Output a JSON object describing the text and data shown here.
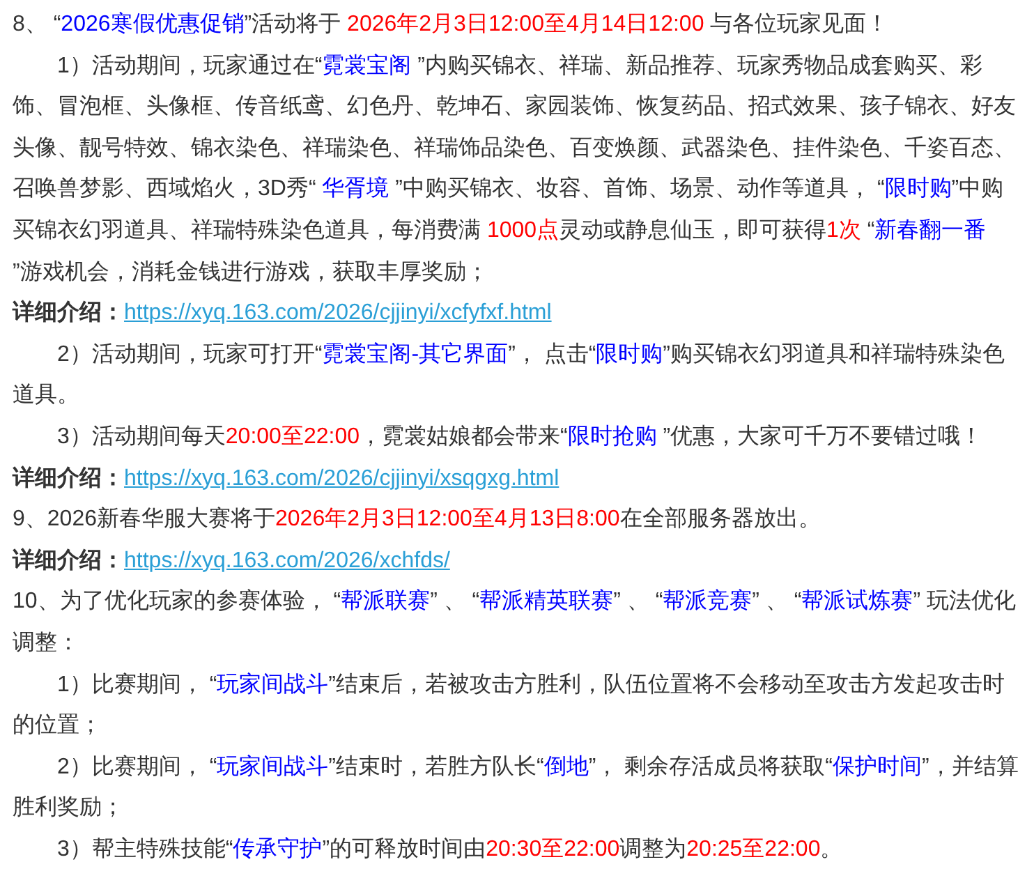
{
  "blocks": [
    {
      "kind": "para",
      "runs": [
        {
          "kind": "plain",
          "text": "8、 “"
        },
        {
          "kind": "blue",
          "text": "2026寒假优惠促销"
        },
        {
          "kind": "plain",
          "text": "”活动将于 "
        },
        {
          "kind": "red",
          "text": "2026年2月3日12:00至4月14日12:00"
        },
        {
          "kind": "plain",
          "text": " 与各位玩家见面！"
        }
      ]
    },
    {
      "kind": "sub",
      "runs": [
        {
          "kind": "plain",
          "text": "1）活动期间，玩家通过在“"
        },
        {
          "kind": "blue",
          "text": "霓裳宝阁"
        },
        {
          "kind": "plain",
          "text": " ”内购买锦衣、祥瑞、新品推荐、玩家秀物品成套购买、彩饰、冒泡框、头像框、传音纸鸢、幻色丹、乾坤石、家园装饰、恢复药品、招式效果、孩子锦衣、好友头像、靓号特效、锦衣染色、祥瑞染色、祥瑞饰品染色、百变焕颜、武器染色、挂件染色、千姿百态、召唤兽梦影、西域焰火，3D秀“ "
        },
        {
          "kind": "blue",
          "text": "华胥境"
        },
        {
          "kind": "plain",
          "text": " ”中购买锦衣、妆容、首饰、场景、动作等道具， “"
        },
        {
          "kind": "blue",
          "text": "限时购"
        },
        {
          "kind": "plain",
          "text": "”中购买锦衣幻羽道具、祥瑞特殊染色道具，每消费满 "
        },
        {
          "kind": "red",
          "text": "1000点"
        },
        {
          "kind": "plain",
          "text": "灵动或静息仙玉，即可获得"
        },
        {
          "kind": "red",
          "text": "1次"
        },
        {
          "kind": "plain",
          "text": " “"
        },
        {
          "kind": "blue",
          "text": "新春翻一番"
        },
        {
          "kind": "plain",
          "text": " ”游戏机会，消耗金钱进行游戏，获取丰厚奖励；"
        }
      ]
    },
    {
      "kind": "detail",
      "label": "详细介绍：",
      "link": "https://xyq.163.com/2026/cjjinyi/xcfyfxf.html"
    },
    {
      "kind": "sub",
      "runs": [
        {
          "kind": "plain",
          "text": "2）活动期间，玩家可打开“"
        },
        {
          "kind": "blue",
          "text": "霓裳宝阁-其它界面"
        },
        {
          "kind": "plain",
          "text": "”， 点击“"
        },
        {
          "kind": "blue",
          "text": "限时购"
        },
        {
          "kind": "plain",
          "text": "”购买锦衣幻羽道具和祥瑞特殊染色道具。"
        }
      ]
    },
    {
      "kind": "sub",
      "runs": [
        {
          "kind": "plain",
          "text": "3）活动期间每天"
        },
        {
          "kind": "red",
          "text": "20:00至22:00"
        },
        {
          "kind": "plain",
          "text": "，霓裳姑娘都会带来“"
        },
        {
          "kind": "blue",
          "text": "限时抢购"
        },
        {
          "kind": "plain",
          "text": " ”优惠，大家可千万不要错过哦！"
        }
      ]
    },
    {
      "kind": "detail",
      "label": "详细介绍：",
      "link": "https://xyq.163.com/2026/cjjinyi/xsqgxg.html"
    },
    {
      "kind": "para",
      "runs": [
        {
          "kind": "plain",
          "text": "9、2026新春华服大赛将于"
        },
        {
          "kind": "red",
          "text": "2026年2月3日12:00至4月13日8:00"
        },
        {
          "kind": "plain",
          "text": "在全部服务器放出。"
        }
      ]
    },
    {
      "kind": "detail",
      "label": "详细介绍：",
      "link": "https://xyq.163.com/2026/xchfds/"
    },
    {
      "kind": "para",
      "runs": [
        {
          "kind": "plain",
          "text": "10、为了优化玩家的参赛体验， “"
        },
        {
          "kind": "blue",
          "text": "帮派联赛"
        },
        {
          "kind": "plain",
          "text": "” 、 “"
        },
        {
          "kind": "blue",
          "text": "帮派精英联赛"
        },
        {
          "kind": "plain",
          "text": "” 、 “"
        },
        {
          "kind": "blue",
          "text": "帮派竞赛"
        },
        {
          "kind": "plain",
          "text": "” 、 “"
        },
        {
          "kind": "blue",
          "text": "帮派试炼赛"
        },
        {
          "kind": "plain",
          "text": "” 玩法优化调整："
        }
      ]
    },
    {
      "kind": "sub",
      "runs": [
        {
          "kind": "plain",
          "text": "1）比赛期间， “"
        },
        {
          "kind": "blue",
          "text": "玩家间战斗"
        },
        {
          "kind": "plain",
          "text": "”结束后，若被攻击方胜利，队伍位置将不会移动至攻击方发起攻击时的位置；"
        }
      ]
    },
    {
      "kind": "sub",
      "runs": [
        {
          "kind": "plain",
          "text": "2）比赛期间， “"
        },
        {
          "kind": "blue",
          "text": "玩家间战斗"
        },
        {
          "kind": "plain",
          "text": "”结束时，若胜方队长“"
        },
        {
          "kind": "blue",
          "text": "倒地"
        },
        {
          "kind": "plain",
          "text": "”， 剩余存活成员将获取“"
        },
        {
          "kind": "blue",
          "text": "保护时间"
        },
        {
          "kind": "plain",
          "text": "”，并结算胜利奖励；"
        }
      ]
    },
    {
      "kind": "sub",
      "runs": [
        {
          "kind": "plain",
          "text": "3）帮主特殊技能“"
        },
        {
          "kind": "blue",
          "text": "传承守护"
        },
        {
          "kind": "plain",
          "text": "”的可释放时间由"
        },
        {
          "kind": "red",
          "text": "20:30至22:00"
        },
        {
          "kind": "plain",
          "text": "调整为"
        },
        {
          "kind": "red",
          "text": "20:25至22:00"
        },
        {
          "kind": "plain",
          "text": "。"
        }
      ]
    }
  ]
}
